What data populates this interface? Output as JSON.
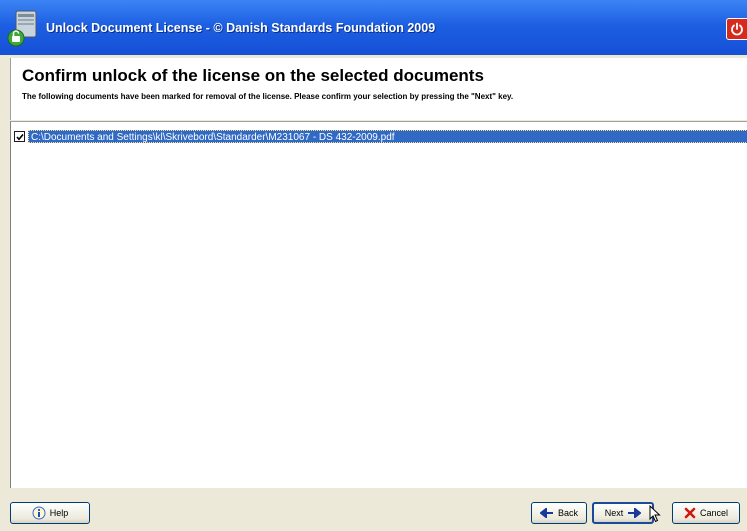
{
  "window": {
    "title": "Unlock Document License  -  © Danish Standards Foundation 2009"
  },
  "header": {
    "heading": "Confirm unlock of the license on the selected documents",
    "subheading": "The following documents have been marked for removal of the license. Please confirm your selection by pressing the \"Next\" key."
  },
  "documents": [
    {
      "path": "C:\\Documents and Settings\\kl\\Skrivebord\\Standarder\\M231067 - DS 432-2009.pdf",
      "checked": true
    }
  ],
  "footer": {
    "help_label": "Help",
    "back_label": "Back",
    "next_label": "Next",
    "cancel_label": "Cancel"
  },
  "colors": {
    "titlebar": "#1d5fe2",
    "selection": "#316ac5",
    "power": "#d62a1c"
  }
}
